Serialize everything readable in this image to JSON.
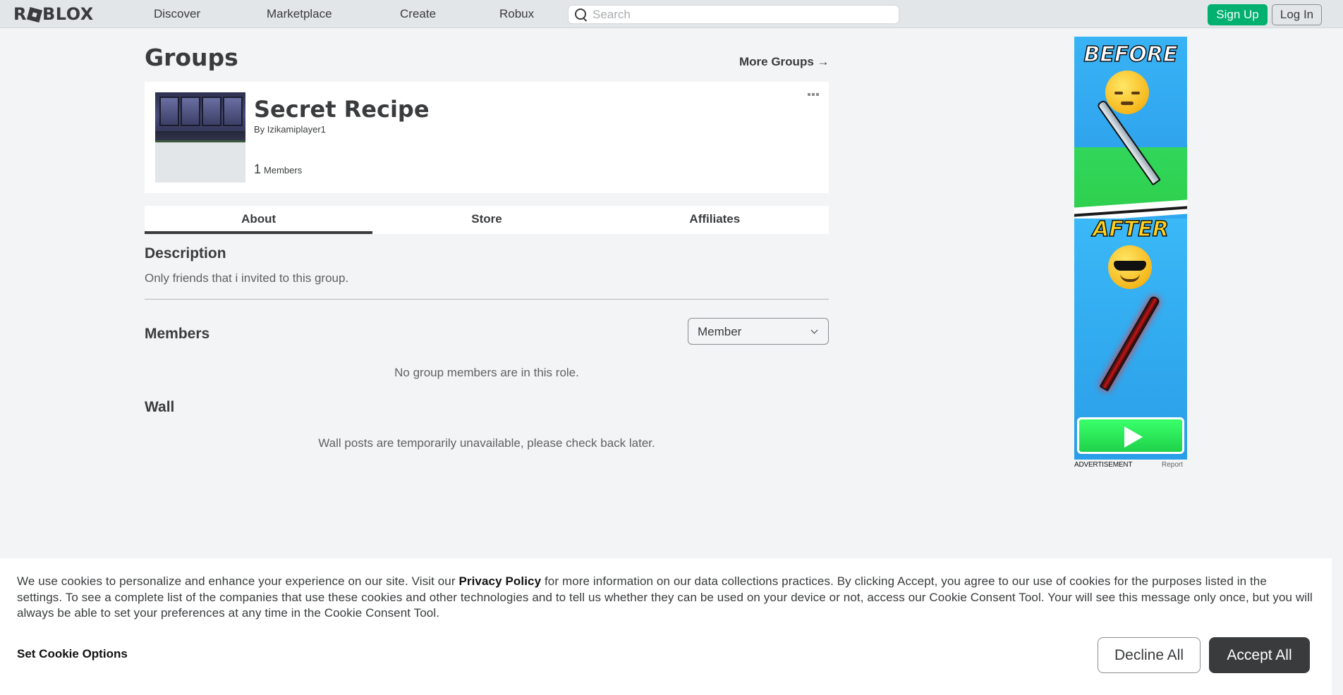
{
  "header": {
    "logo_text": "ROBLOX",
    "nav": [
      {
        "label": "Discover"
      },
      {
        "label": "Marketplace"
      },
      {
        "label": "Create"
      },
      {
        "label": "Robux"
      }
    ],
    "search_placeholder": "Search",
    "signup_label": "Sign Up",
    "login_label": "Log In"
  },
  "page": {
    "title": "Groups",
    "more_groups_label": "More Groups →"
  },
  "group": {
    "name": "Secret Recipe",
    "by_label": "By",
    "owner": "Izikamiplayer1",
    "member_count": "1",
    "members_label": "Members"
  },
  "tabs": [
    {
      "label": "About",
      "active": true
    },
    {
      "label": "Store",
      "active": false
    },
    {
      "label": "Affiliates",
      "active": false
    }
  ],
  "about": {
    "description_heading": "Description",
    "description_text": "Only friends that i invited to this group.",
    "members_heading": "Members",
    "role_selected": "Member",
    "members_empty": "No group members are in this role.",
    "wall_heading": "Wall",
    "wall_empty": "Wall posts are temporarily unavailable, please check back later."
  },
  "ad": {
    "before_text": "BEFORE",
    "after_text": "AFTER",
    "label": "ADVERTISEMENT",
    "report_label": "Report"
  },
  "cookie_banner": {
    "text_before": "We use cookies to personalize and enhance your experience on our site. Visit our ",
    "privacy_link": "Privacy Policy",
    "text_after": " for more information on our data collections practices. By clicking Accept, you agree to our use of cookies for the purposes listed in the settings. To see a complete list of the companies that use these cookies and other technologies and to tell us whether they can be used on your device or not, access our Cookie Consent Tool. Your will see this message only once, but you will always be able to set your preferences at any time in the Cookie Consent Tool.",
    "options_label": "Set Cookie Options",
    "decline_label": "Decline All",
    "accept_label": "Accept All"
  },
  "colors": {
    "accent_green": "#00b06f",
    "text_primary": "#393b3d",
    "background": "#f2f4f5"
  }
}
